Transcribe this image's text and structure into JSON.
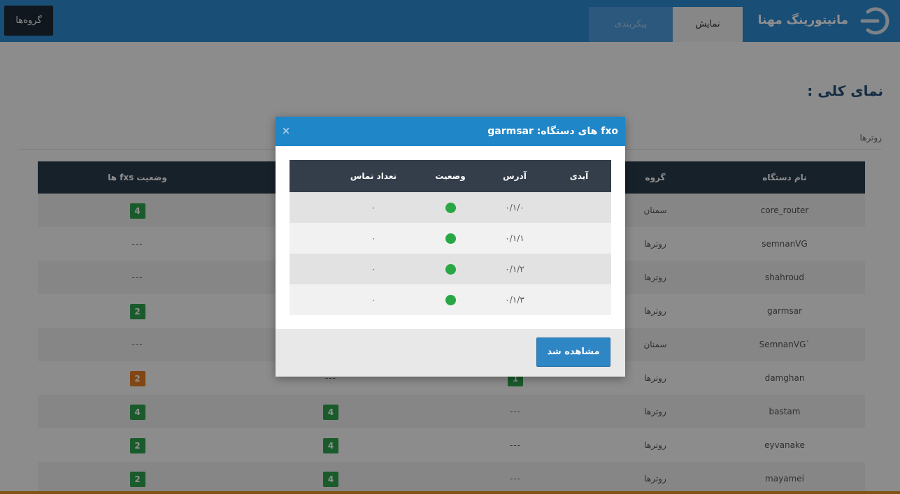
{
  "header": {
    "app_title": "مانیتورینگ مهنا",
    "tabs": [
      {
        "label": "نمایش",
        "active": true
      },
      {
        "label": "پیکربندی",
        "active": false
      }
    ],
    "groups_button": "گروه‌ها",
    "accent_color": "#2d8bd4"
  },
  "page": {
    "title": "نمای کلی :",
    "breadcrumb": "روترها"
  },
  "devices_table": {
    "headers": {
      "name": "نام دستگاه",
      "group": "گروه",
      "fxs_status": "وضعیت fxs ها"
    },
    "rows": [
      {
        "name": "core_router",
        "group": "سمنان",
        "fxs": "4",
        "fxs_color": "green",
        "col3": "",
        "col4": ""
      },
      {
        "name": "semnanVG",
        "group": "روترها",
        "fxs": "---",
        "fxs_color": "",
        "col3": "",
        "col4": ""
      },
      {
        "name": "shahroud",
        "group": "روترها",
        "fxs": "---",
        "fxs_color": "",
        "col3": "",
        "col4": ""
      },
      {
        "name": "garmsar",
        "group": "روترها",
        "fxs": "2",
        "fxs_color": "green",
        "col3": "",
        "col4": ""
      },
      {
        "name": "SemnanVG`",
        "group": "سمنان",
        "fxs": "---",
        "fxs_color": "",
        "col3": "",
        "col4": ""
      },
      {
        "name": "damghan",
        "group": "روترها",
        "fxs": "2",
        "fxs_color": "orange",
        "col3": "1",
        "col4": "---"
      },
      {
        "name": "bastam",
        "group": "روترها",
        "fxs": "4",
        "fxs_color": "green",
        "col3": "---",
        "col4": "4"
      },
      {
        "name": "eyvanake",
        "group": "روترها",
        "fxs": "2",
        "fxs_color": "green",
        "col3": "---",
        "col4": "4"
      },
      {
        "name": "mayamei",
        "group": "روترها",
        "fxs": "2",
        "fxs_color": "green",
        "col3": "---",
        "col4": "4"
      }
    ]
  },
  "modal": {
    "title": "fxo های دستگاه: garmsar",
    "close_glyph": "×",
    "headers": {
      "id": "آیدی",
      "address": "آدرس",
      "status": "وضعیت",
      "call_count": "تعداد تماس"
    },
    "rows": [
      {
        "id": "",
        "address": "۰/۱/۰",
        "status": "online",
        "calls": "۰"
      },
      {
        "id": "",
        "address": "۰/۱/۱",
        "status": "online",
        "calls": "۰"
      },
      {
        "id": "",
        "address": "۰/۱/۲",
        "status": "online",
        "calls": "۰"
      },
      {
        "id": "",
        "address": "۰/۱/۳",
        "status": "online",
        "calls": "۰"
      }
    ],
    "seen_button": "مشاهده شد",
    "status_color": "#28a745"
  }
}
